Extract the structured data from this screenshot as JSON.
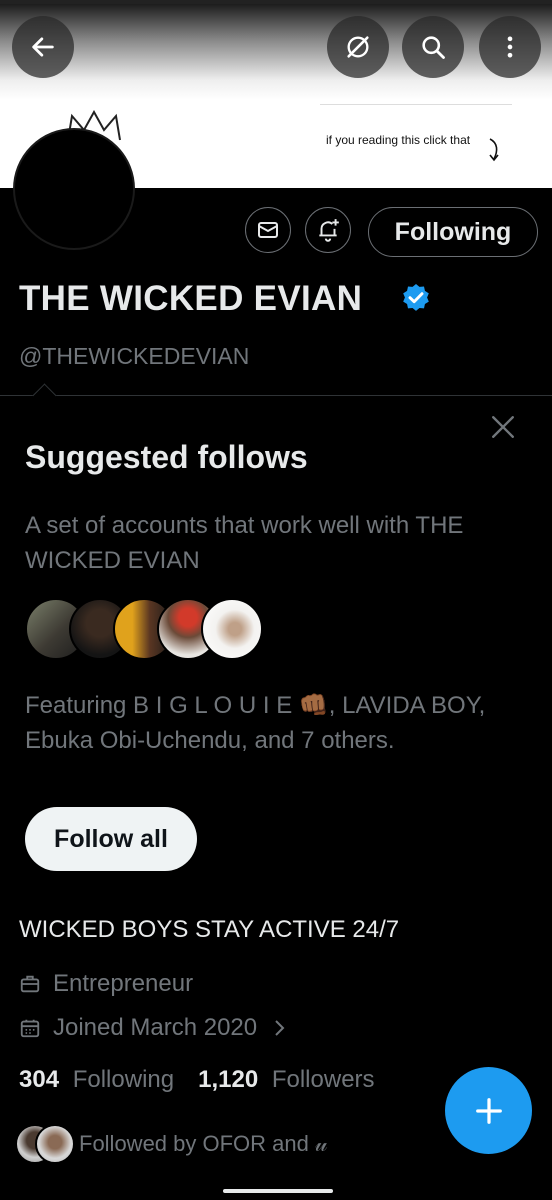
{
  "banner": {
    "note_text": "if you reading this click that"
  },
  "topbar": {
    "back_icon": "arrow-left-icon",
    "grok_icon": "grok-icon",
    "search_icon": "search-icon",
    "more_icon": "more-vertical-icon"
  },
  "profile": {
    "name": "THE WICKED EVIAN",
    "handle": "@THEWICKEDEVIAN",
    "following_button": "Following",
    "message_icon": "envelope-icon",
    "notify_icon": "bell-plus-icon",
    "verified_color": "#1d9bf0"
  },
  "suggested": {
    "title": "Suggested follows",
    "description": "A set of accounts that work well with THE WICKED EVIAN",
    "featuring": "Featuring B I G L O U I E 👊🏾, LAVIDA BOY, Ebuka Obi-Uchendu, and 7 others.",
    "follow_all": "Follow all"
  },
  "bio": {
    "text": "WICKED BOYS STAY ACTIVE 24/7",
    "profession": "Entrepreneur",
    "joined": "Joined March 2020"
  },
  "stats": {
    "following_count": "304",
    "following_label": "Following",
    "followers_count": "1,120",
    "followers_label": "Followers"
  },
  "followed_by": "Followed by OFOR and 𝓊",
  "colors": {
    "accent": "#1d9bf0",
    "muted": "#71767b",
    "text": "#e7e9ea"
  }
}
